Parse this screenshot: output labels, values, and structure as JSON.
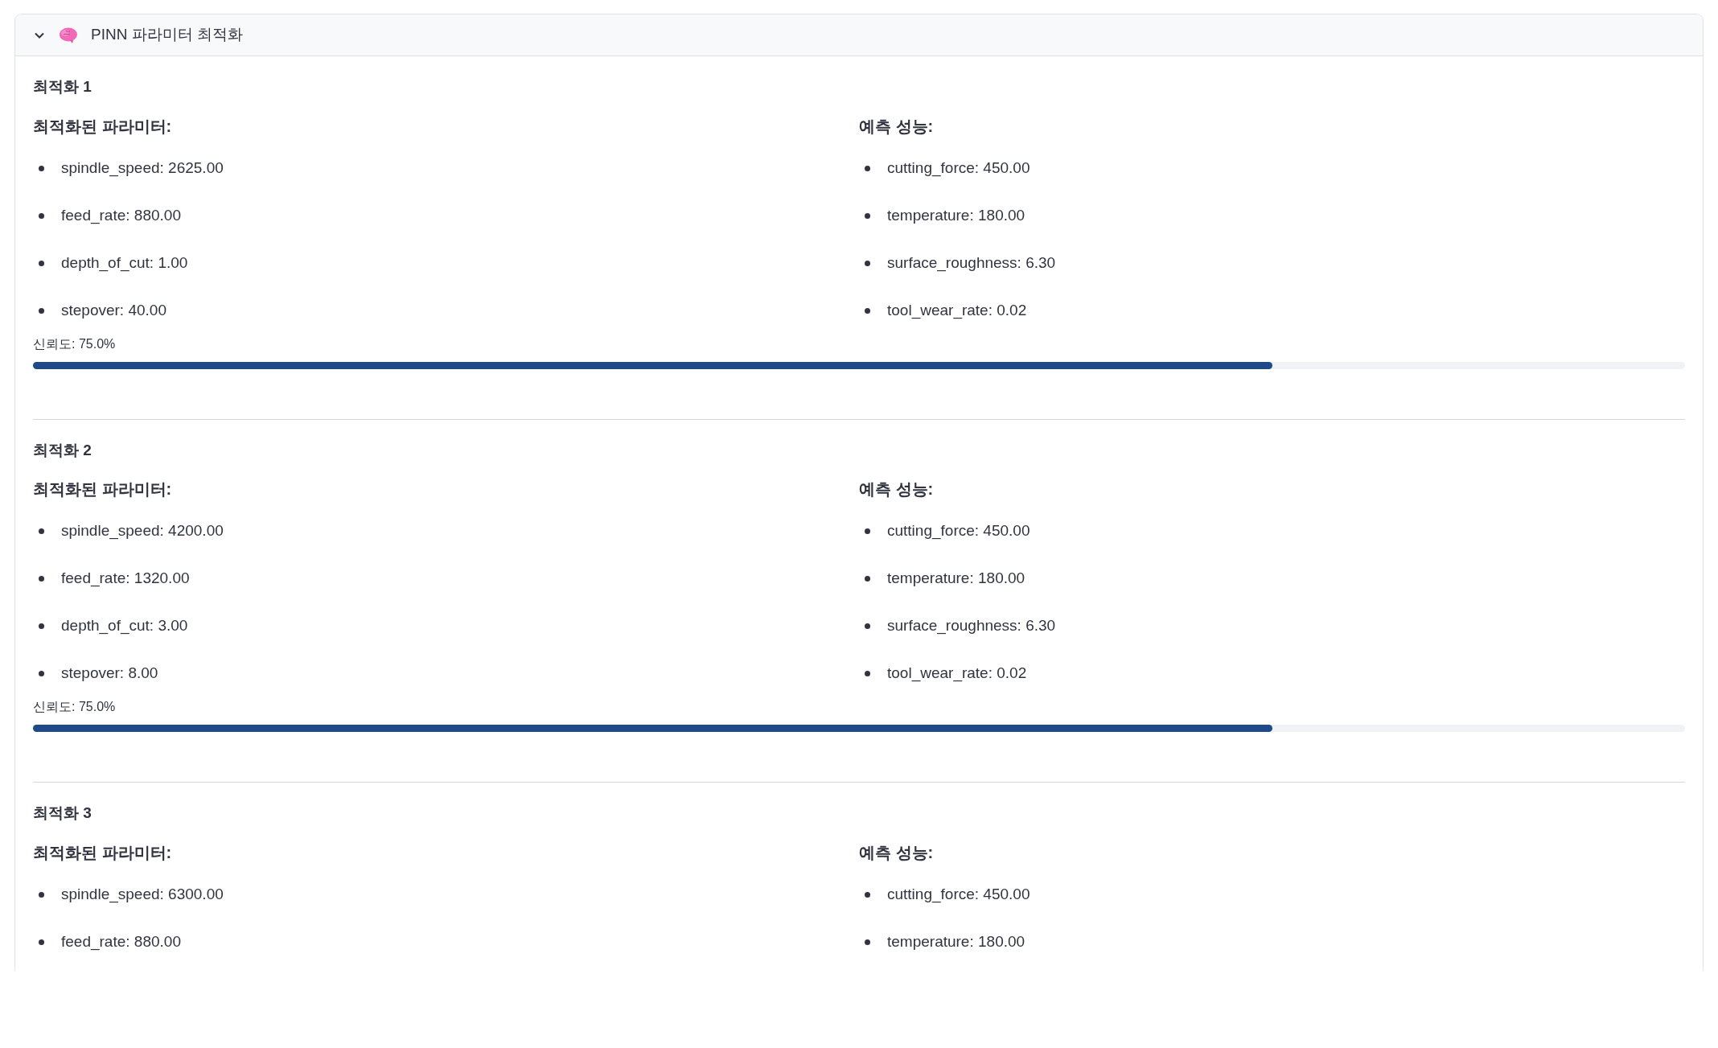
{
  "expander": {
    "title": "PINN 파라미터 최적화",
    "expanded": true
  },
  "optimizations": [
    {
      "title": "최적화 1",
      "params_heading": "최적화된 파라미터:",
      "params": [
        "spindle_speed: 2625.00",
        "feed_rate: 880.00",
        "depth_of_cut: 1.00",
        "stepover: 40.00"
      ],
      "perf_heading": "예측 성능:",
      "performance": [
        "cutting_force: 450.00",
        "temperature: 180.00",
        "surface_roughness: 6.30",
        "tool_wear_rate: 0.02"
      ],
      "confidence": {
        "label": "신뢰도: 75.0%",
        "level": 0.75
      }
    },
    {
      "title": "최적화 2",
      "params_heading": "최적화된 파라미터:",
      "params": [
        "spindle_speed: 4200.00",
        "feed_rate: 1320.00",
        "depth_of_cut: 3.00",
        "stepover: 8.00"
      ],
      "perf_heading": "예측 성능:",
      "performance": [
        "cutting_force: 450.00",
        "temperature: 180.00",
        "surface_roughness: 6.30",
        "tool_wear_rate: 0.02"
      ],
      "confidence": {
        "label": "신뢰도: 75.0%",
        "level": 0.75
      }
    },
    {
      "title": "최적화 3",
      "params_heading": "최적화된 파라미터:",
      "params": [
        "spindle_speed: 6300.00",
        "feed_rate: 880.00"
      ],
      "perf_heading": "예측 성능:",
      "performance": [
        "cutting_force: 450.00",
        "temperature: 180.00"
      ]
    }
  ]
}
